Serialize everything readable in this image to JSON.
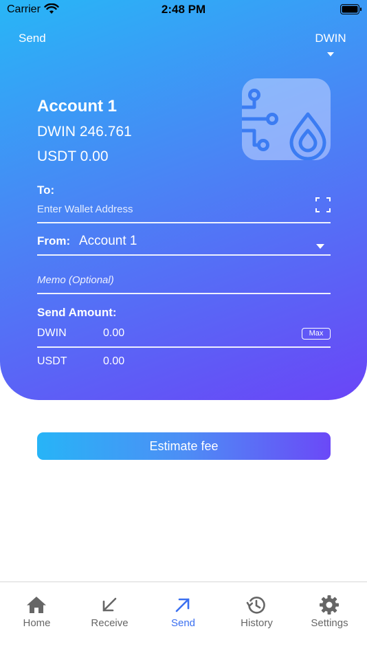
{
  "status_bar": {
    "carrier": "Carrier",
    "time": "2:48 PM"
  },
  "header": {
    "title": "Send",
    "currency": "DWIN"
  },
  "account": {
    "name": "Account 1",
    "balance_dwin": "DWIN 246.761",
    "balance_usdt": "USDT 0.00"
  },
  "form": {
    "to_label": "To:",
    "to_placeholder": "Enter Wallet Address",
    "from_label": "From:",
    "from_value": "Account 1",
    "memo_placeholder": "Memo (Optional)",
    "amount_label": "Send Amount:",
    "amounts": [
      {
        "currency": "DWIN",
        "value": "0.00"
      },
      {
        "currency": "USDT",
        "value": "0.00"
      }
    ],
    "max_label": "Max"
  },
  "actions": {
    "estimate_label": "Estimate fee"
  },
  "tabs": [
    {
      "label": "Home",
      "icon": "home-icon",
      "active": false
    },
    {
      "label": "Receive",
      "icon": "receive-arrow-icon",
      "active": false
    },
    {
      "label": "Send",
      "icon": "send-arrow-icon",
      "active": true
    },
    {
      "label": "History",
      "icon": "history-icon",
      "active": false
    },
    {
      "label": "Settings",
      "icon": "gear-icon",
      "active": false
    }
  ],
  "colors": {
    "accent": "#3a6ff0",
    "gradient_start": "#28b6f6",
    "gradient_end": "#6a45f7"
  }
}
